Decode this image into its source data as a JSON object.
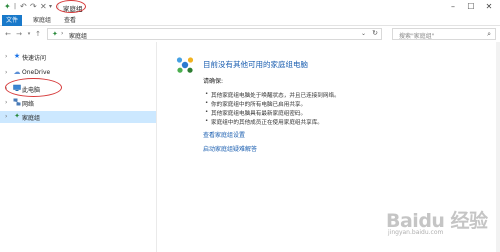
{
  "titlebar": {
    "title": "家庭组",
    "quick_access": [
      "save-icon",
      "undo-icon",
      "redo-icon",
      "close-x-icon",
      "dropdown-icon"
    ],
    "controls": [
      "minimize-icon",
      "maximize-icon",
      "close-icon"
    ]
  },
  "ribbon": {
    "tabs": [
      {
        "label": "文件"
      },
      {
        "label": "家庭组"
      },
      {
        "label": "查看"
      }
    ]
  },
  "address": {
    "path_label": "家庭组",
    "search_placeholder": "搜索\"家庭组\""
  },
  "sidebar": {
    "items": [
      {
        "label": "快速访问",
        "icon": "star-icon",
        "color": "#1a73e8"
      },
      {
        "label": "OneDrive",
        "icon": "cloud-icon",
        "color": "#5b8fd6"
      },
      {
        "label": "此电脑",
        "icon": "computer-icon",
        "color": "#2b6cb0"
      },
      {
        "label": "网络",
        "icon": "network-icon",
        "color": "#4a7bb7"
      },
      {
        "label": "家庭组",
        "icon": "homegroup-icon",
        "color": "#2a8a3c",
        "selected": true
      }
    ]
  },
  "main": {
    "title": "目前没有其他可用的家庭组电脑",
    "intro": "请确保:",
    "bullets": [
      "其他家庭组电脑处于唤醒状态，并且已连接到网络。",
      "你的家庭组中的所有电脑已启用共享。",
      "其他家庭组电脑具有最新家庭组密码。",
      "家庭组中的其他成员正在使用家庭组共享库。"
    ],
    "links": [
      "查看家庭组设置",
      "启动家庭组疑难解答"
    ]
  },
  "watermark": {
    "text": "Baidu 经验",
    "sub1": "jingyan.baidu.com",
    "sub2": ""
  },
  "colors": {
    "accent": "#1979ca",
    "link": "#1a5eb0",
    "selected_bg": "#cce8ff",
    "annotation": "#d63a3a"
  }
}
